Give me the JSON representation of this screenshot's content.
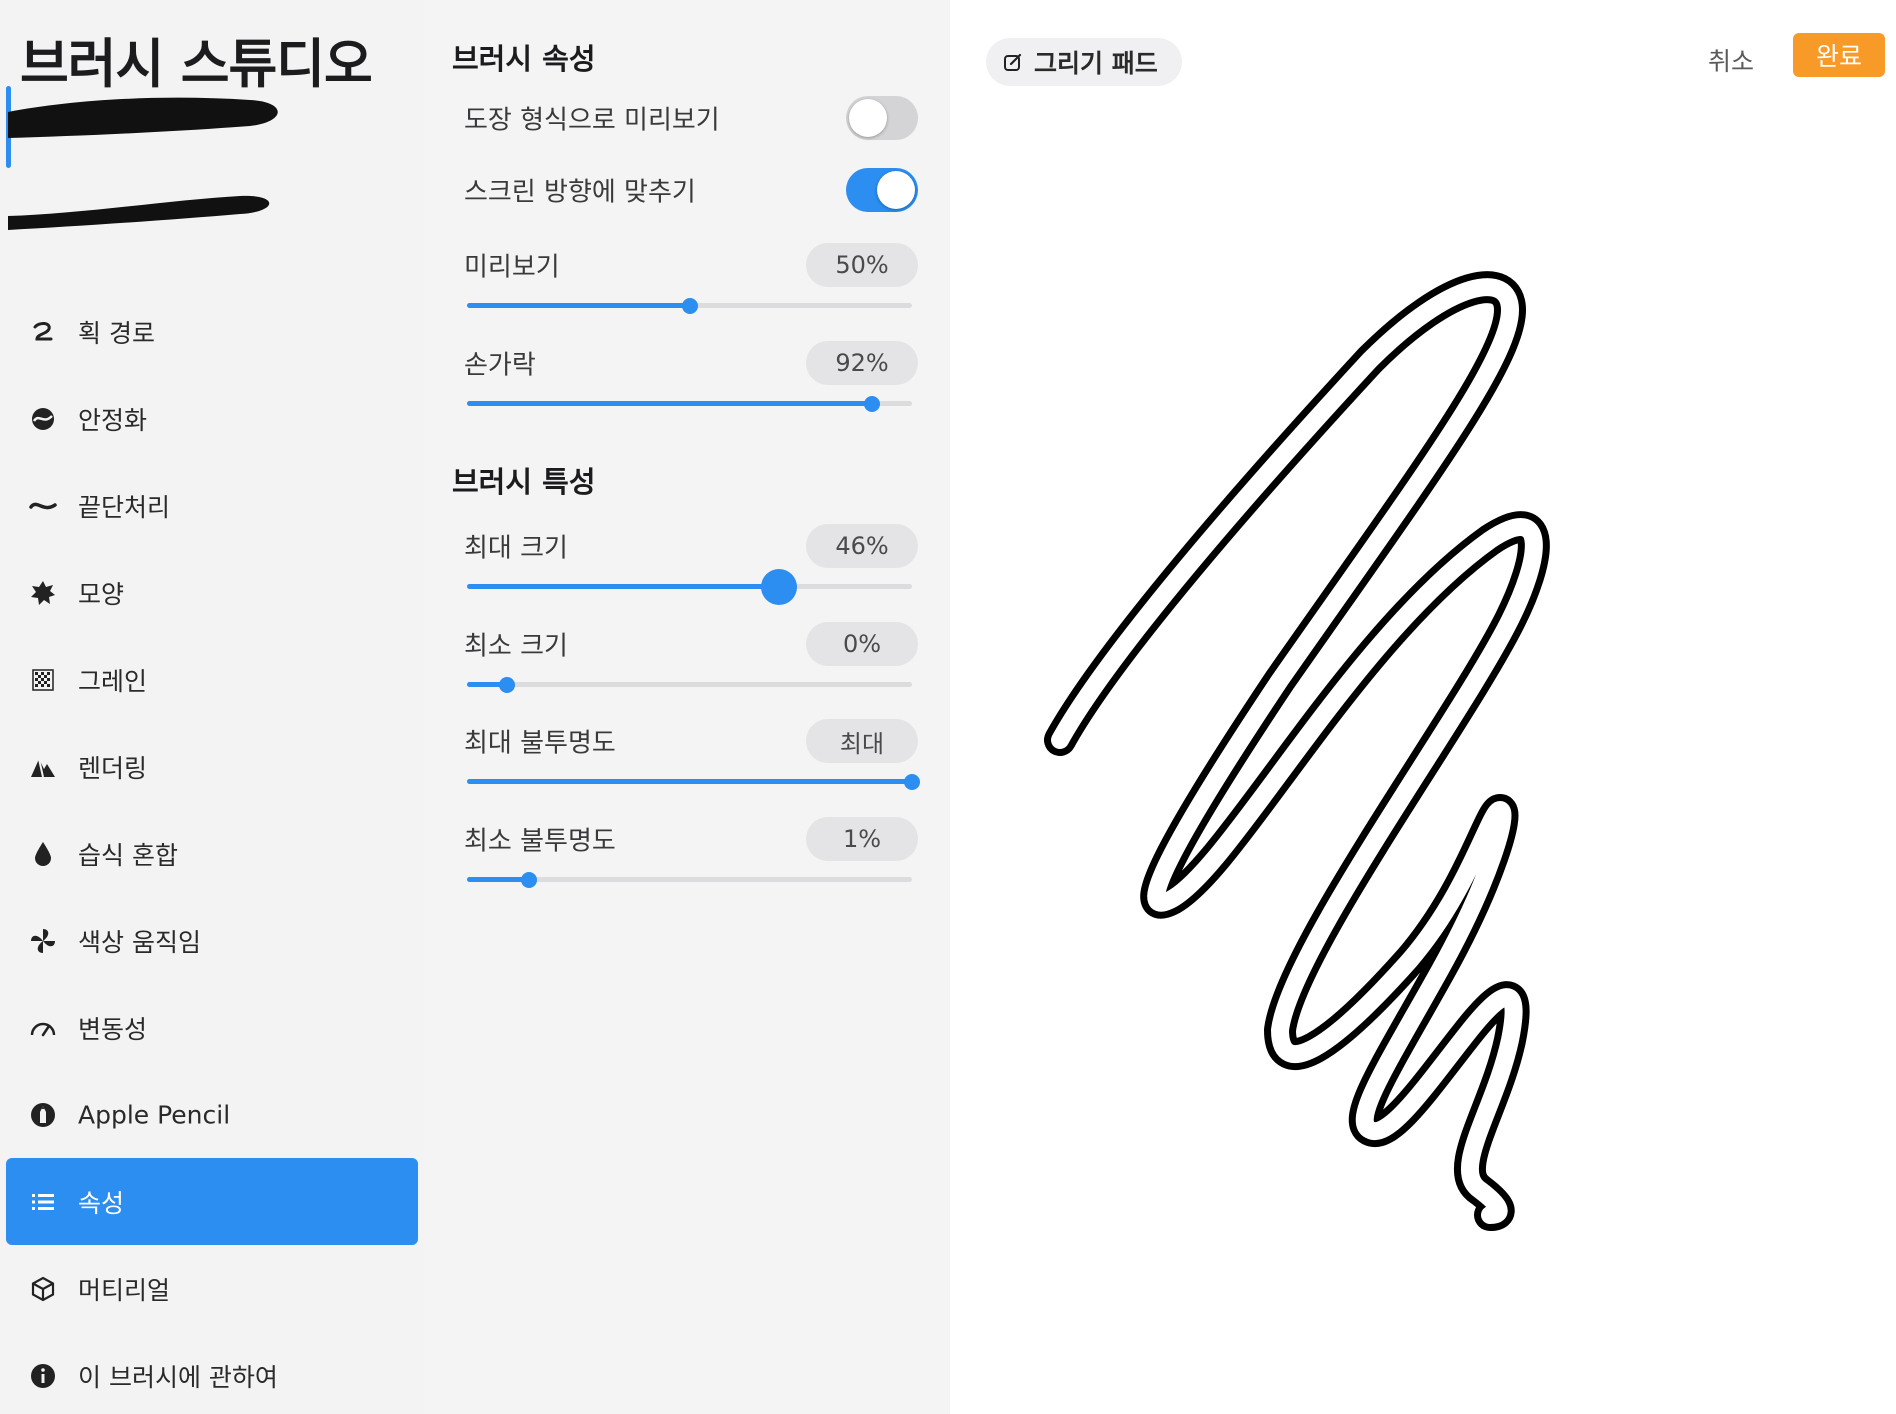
{
  "sidebar": {
    "title": "브러시 스튜디오",
    "items": [
      {
        "label": "획 경로",
        "icon": "stroke-path-icon"
      },
      {
        "label": "안정화",
        "icon": "stabilization-icon"
      },
      {
        "label": "끝단처리",
        "icon": "taper-icon"
      },
      {
        "label": "모양",
        "icon": "shape-icon"
      },
      {
        "label": "그레인",
        "icon": "grain-icon"
      },
      {
        "label": "렌더링",
        "icon": "rendering-icon"
      },
      {
        "label": "습식 혼합",
        "icon": "wet-mix-icon"
      },
      {
        "label": "색상 움직임",
        "icon": "color-dynamics-icon"
      },
      {
        "label": "변동성",
        "icon": "dynamics-icon"
      },
      {
        "label": "Apple Pencil",
        "icon": "apple-pencil-icon"
      },
      {
        "label": "속성",
        "icon": "properties-icon",
        "active": true
      },
      {
        "label": "머티리얼",
        "icon": "materials-icon"
      },
      {
        "label": "이 브러시에 관하여",
        "icon": "info-icon"
      }
    ]
  },
  "panel": {
    "section1_title": "브러시 속성",
    "toggle1": {
      "label": "도장 형식으로 미리보기",
      "on": false
    },
    "toggle2": {
      "label": "스크린 방향에 맞추기",
      "on": true
    },
    "preview": {
      "label": "미리보기",
      "value": "50%",
      "level": 0.5
    },
    "finger": {
      "label": "손가락",
      "value": "92%",
      "level": 0.92
    },
    "section2_title": "브러시 특성",
    "max_size": {
      "label": "최대 크기",
      "value": "46%",
      "level": 0.7
    },
    "min_size": {
      "label": "최소 크기",
      "value": "0%",
      "level": 0.09
    },
    "max_opacity": {
      "label": "최대 불투명도",
      "value": "최대",
      "level": 1.0
    },
    "min_opacity": {
      "label": "최소 불투명도",
      "value": "1%",
      "level": 0.14
    }
  },
  "pad": {
    "chip_label": "그리기 패드",
    "cancel_label": "취소",
    "done_label": "완료"
  },
  "colors": {
    "accent": "#2b8ef0",
    "done": "#f79a27"
  }
}
